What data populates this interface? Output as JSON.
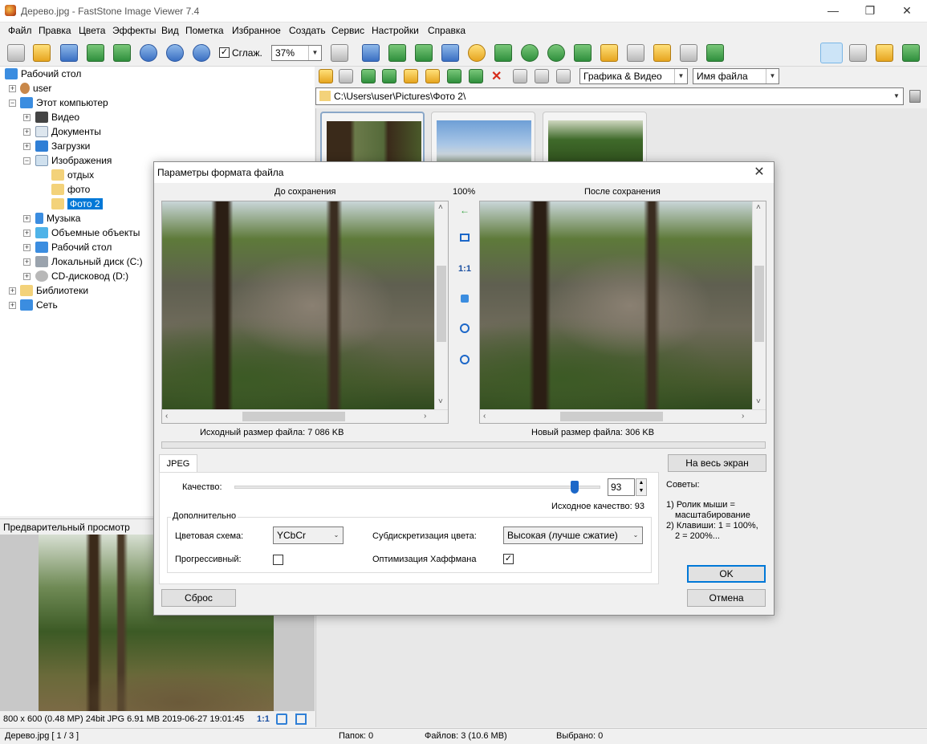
{
  "window": {
    "title": "Дерево.jpg  -  FastStone Image Viewer 7.4",
    "minimize": "—",
    "maximize": "❐",
    "close": "✕"
  },
  "menu": [
    "Файл",
    "Правка",
    "Цвета",
    "Эффекты",
    "Вид",
    "Пометка",
    "Избранное",
    "Создать",
    "Сервис",
    "Настройки",
    "Справка"
  ],
  "toolbar": {
    "smooth_label": "Сглаж.",
    "smooth_checked": true,
    "zoom_value": "37%",
    "check_mark": "✓"
  },
  "tree": {
    "items": [
      {
        "label": "Рабочий стол",
        "icon": "desktop-icon"
      },
      {
        "label": "user",
        "icon": "user-icon"
      },
      {
        "label": "Этот компьютер",
        "icon": "computer-icon"
      },
      {
        "label": "Видео",
        "icon": "video-folder-icon"
      },
      {
        "label": "Документы",
        "icon": "documents-folder-icon"
      },
      {
        "label": "Загрузки",
        "icon": "downloads-icon"
      },
      {
        "label": "Изображения",
        "icon": "pictures-folder-icon"
      },
      {
        "label": "отдых",
        "icon": "folder-icon"
      },
      {
        "label": "фото",
        "icon": "folder-icon"
      },
      {
        "label": "Фото 2",
        "icon": "folder-icon",
        "selected": true
      },
      {
        "label": "Музыка",
        "icon": "music-icon"
      },
      {
        "label": "Объемные объекты",
        "icon": "3d-objects-icon"
      },
      {
        "label": "Рабочий стол",
        "icon": "desktop-icon"
      },
      {
        "label": "Локальный диск (C:)",
        "icon": "drive-icon"
      },
      {
        "label": "CD-дисковод (D:)",
        "icon": "cd-drive-icon"
      },
      {
        "label": "Библиотеки",
        "icon": "libraries-icon"
      },
      {
        "label": "Сеть",
        "icon": "network-icon"
      }
    ]
  },
  "preview": {
    "header": "Предварительный просмотр",
    "info": "800 x 600 (0.48 MP)   24bit   JPG   6.91 MB   2019-06-27 19:01:45",
    "one_to_one": "1:1"
  },
  "browser": {
    "filter": "Графика & Видео",
    "sort": "Имя файла",
    "path": "C:\\Users\\user\\Pictures\\Фото 2\\"
  },
  "status": {
    "file": "Дерево.jpg [ 1 / 3 ]",
    "folders": "Папок: 0",
    "files": "Файлов: 3 (10.6 MB)",
    "selected": "Выбрано: 0"
  },
  "dialog": {
    "title": "Параметры формата файла",
    "close": "✕",
    "before_label": "До сохранения",
    "zoom": "100%",
    "after_label": "После сохранения",
    "one_to_one": "1:1",
    "original_size": "Исходный размер файла:  7 086 KB",
    "new_size": "Новый размер файла:  306 KB",
    "tab": "JPEG",
    "fullscreen_button": "На весь экран",
    "quality_label": "Качество:",
    "quality_value": "93",
    "quality_fraction": 0.93,
    "original_quality": "Исходное качество: 93",
    "advanced_group": "Дополнительно",
    "color_scheme_label": "Цветовая схема:",
    "color_scheme_value": "YCbCr",
    "subsampling_label": "Субдискретизация цвета:",
    "subsampling_value": "Высокая (лучше сжатие)",
    "progressive_label": "Прогрессивный:",
    "progressive_checked": false,
    "huffman_label": "Оптимизация Хаффмана",
    "huffman_checked": true,
    "check_mark": "✓",
    "tips_title": "Советы:",
    "tip1_line1": "1) Ролик мыши =",
    "tip1_line2": "масштабирование",
    "tip2_line1": "2) Клавиши: 1 = 100%,",
    "tip2_line2": "2 = 200%...",
    "ok_button": "OK",
    "cancel_button": "Отмена",
    "reset_button": "Сброс"
  }
}
